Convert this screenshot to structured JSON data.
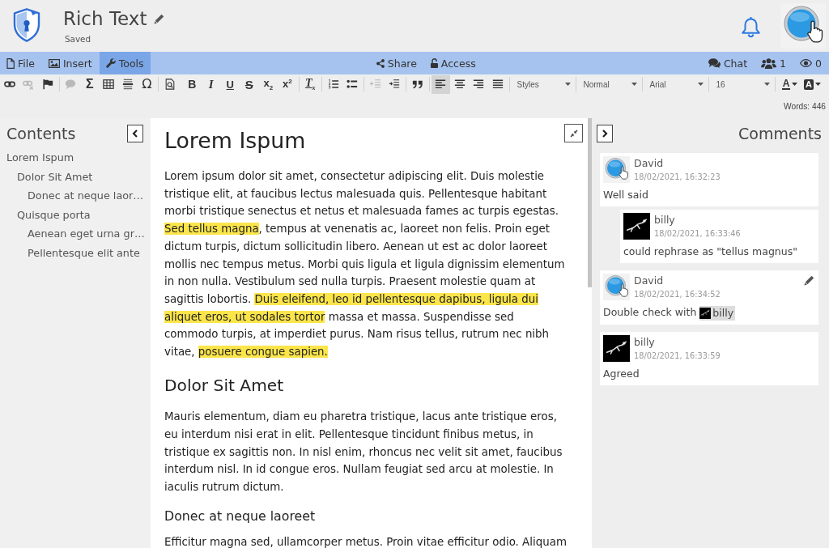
{
  "header": {
    "title": "Rich Text",
    "status": "Saved"
  },
  "menu_bar": {
    "left": [
      {
        "label": "File",
        "kind": "file",
        "selected": false
      },
      {
        "label": "Insert",
        "kind": "image",
        "selected": false
      },
      {
        "label": "Tools",
        "kind": "wrench",
        "selected": true
      }
    ],
    "center": [
      {
        "label": "Share",
        "kind": "share"
      },
      {
        "label": "Access",
        "kind": "lock"
      }
    ],
    "right": [
      {
        "label": "Chat",
        "kind": "chat"
      },
      {
        "label": "1",
        "kind": "users"
      },
      {
        "label": "0",
        "kind": "eye"
      }
    ]
  },
  "toolbar": {
    "items": [
      {
        "kind": "link",
        "disabled": false,
        "selected": false
      },
      {
        "kind": "unlink",
        "disabled": true,
        "selected": false
      },
      {
        "kind": "flag",
        "disabled": false,
        "selected": false
      },
      {
        "kind": "separator"
      },
      {
        "kind": "comment",
        "disabled": true,
        "selected": false
      },
      {
        "kind": "sum",
        "glyph": "Σ",
        "disabled": false,
        "selected": false
      },
      {
        "kind": "table",
        "disabled": false,
        "selected": false
      },
      {
        "kind": "rule",
        "disabled": false,
        "selected": false
      },
      {
        "kind": "special-char",
        "glyph": "Ω",
        "disabled": false,
        "selected": false
      },
      {
        "kind": "separator"
      },
      {
        "kind": "find",
        "disabled": false,
        "selected": false
      },
      {
        "kind": "bold",
        "glyph": "B",
        "disabled": false,
        "selected": false
      },
      {
        "kind": "italic",
        "glyph": "I",
        "disabled": false,
        "selected": false
      },
      {
        "kind": "underline",
        "glyph": "U",
        "disabled": false,
        "selected": false
      },
      {
        "kind": "strike",
        "glyph": "S",
        "disabled": false,
        "selected": false
      },
      {
        "kind": "subscript",
        "glyph": "x$_{2}$",
        "disabled": false,
        "selected": false
      },
      {
        "kind": "superscript",
        "glyph": "x$^{2}$",
        "disabled": false,
        "selected": false
      },
      {
        "kind": "separator"
      },
      {
        "kind": "clear-format",
        "glyph": "T$_{x}$",
        "disabled": false,
        "selected": false
      },
      {
        "kind": "separator"
      },
      {
        "kind": "numbered-list",
        "disabled": false,
        "selected": false
      },
      {
        "kind": "bullet-list",
        "disabled": false,
        "selected": false
      },
      {
        "kind": "separator"
      },
      {
        "kind": "outdent",
        "disabled": true,
        "selected": false
      },
      {
        "kind": "indent",
        "disabled": false,
        "selected": false
      },
      {
        "kind": "separator"
      },
      {
        "kind": "quote",
        "disabled": false,
        "selected": false
      },
      {
        "kind": "separator"
      },
      {
        "kind": "align-left",
        "disabled": false,
        "selected": true
      },
      {
        "kind": "align-center",
        "disabled": false,
        "selected": false
      },
      {
        "kind": "align-right",
        "disabled": false,
        "selected": false
      },
      {
        "kind": "justify",
        "disabled": false,
        "selected": false
      },
      {
        "kind": "separator"
      },
      {
        "kind": "dropdown",
        "value": "Styles"
      },
      {
        "kind": "separator"
      },
      {
        "kind": "dropdown",
        "value": "Normal"
      },
      {
        "kind": "separator"
      },
      {
        "kind": "dropdown",
        "value": "Arial"
      },
      {
        "kind": "separator"
      },
      {
        "kind": "dropdown",
        "value": "16"
      },
      {
        "kind": "separator"
      },
      {
        "kind": "text-color",
        "glyph": "A",
        "disabled": false,
        "selected": false
      },
      {
        "kind": "highlight-color",
        "glyph": "A",
        "disabled": false,
        "selected": false
      }
    ],
    "word_count": "Words: 446"
  },
  "contents": {
    "title": "Contents",
    "items": [
      {
        "label": "Lorem Ispum",
        "children": [
          {
            "label": "Dolor Sit Amet",
            "children": [
              {
                "label": "Donec at neque laor…"
              }
            ]
          },
          {
            "label": "Quisque porta",
            "children": [
              {
                "label": "Aenean eget urna gr…"
              },
              {
                "label": "Pellentesque elit ante"
              }
            ]
          }
        ]
      }
    ]
  },
  "editor": {
    "blocks": [
      {
        "kind": "h1",
        "text": "Lorem Ispum"
      },
      {
        "kind": "p",
        "runs": [
          {
            "text": "Lorem ipsum dolor sit amet, consectetur adipiscing elit. Duis molestie tristique elit, at faucibus lectus malesuada quis. Pellentesque habitant morbi tristique senectus et netus et malesuada fames ac turpis egestas. ",
            "highlight": false
          },
          {
            "text": "Sed tellus magna",
            "highlight": true
          },
          {
            "text": ", tempus at venenatis ac, laoreet non felis. Proin eget dictum turpis, dictum sollicitudin libero. Aenean ut est ac dolor laoreet mollis nec tempus metus. Morbi quis ligula et ligula dignissim elementum in non nulla. Vestibulum sed nulla turpis. Praesent molestie quam at sagittis lobortis. ",
            "highlight": false
          },
          {
            "text": "Duis eleifend, leo id pellentesque dapibus, ligula dui aliquet eros, ut sodales tortor",
            "highlight": true
          },
          {
            "text": " massa et massa. Suspendisse sed commodo turpis, at imperdiet purus. Nam risus tellus, rutrum nec nibh vitae, ",
            "highlight": false
          },
          {
            "text": "posuere congue sapien.",
            "highlight": true
          }
        ]
      },
      {
        "kind": "h2",
        "text": "Dolor Sit Amet"
      },
      {
        "kind": "p",
        "runs": [
          {
            "text": "Mauris elementum, diam eu pharetra tristique, lacus ante tristique eros, eu interdum nisi erat in elit. Pellentesque tincidunt finibus metus, in tristique ex sagittis non. In nisl enim, rhoncus nec velit sit amet, faucibus interdum nisl. In id congue eros. Nullam feugiat sed arcu at molestie. In iaculis rutrum dictum.",
            "highlight": false
          }
        ]
      },
      {
        "kind": "h3",
        "text": "Donec at neque laoreet"
      },
      {
        "kind": "p",
        "runs": [
          {
            "text": "Efficitur magna sed, ullamcorper metus. Proin vitae efficitur odio. Aliquam",
            "highlight": false
          }
        ]
      }
    ]
  },
  "comments": {
    "title": "Comments",
    "threads": [
      {
        "author": "David",
        "avatar": {
          "kind": "badge"
        },
        "time": "18/02/2021, 16:32:23",
        "text": "Well said",
        "editable": false,
        "replies": [
          {
            "author": "billy",
            "avatar": {
              "kind": "photo"
            },
            "time": "18/02/2021, 16:33:46",
            "text": "could rephrase as \"tellus magnus\"",
            "editable": false
          }
        ]
      },
      {
        "author": "David",
        "avatar": {
          "kind": "badge"
        },
        "time": "18/02/2021, 16:34:52",
        "text": "Double check with",
        "mention": {
          "name": "billy",
          "avatar": {
            "kind": "photo"
          }
        },
        "editable": true
      },
      {
        "author": "billy",
        "avatar": {
          "kind": "photo"
        },
        "time": "18/02/2021, 16:33:59",
        "text": "Agreed",
        "editable": false
      }
    ]
  }
}
